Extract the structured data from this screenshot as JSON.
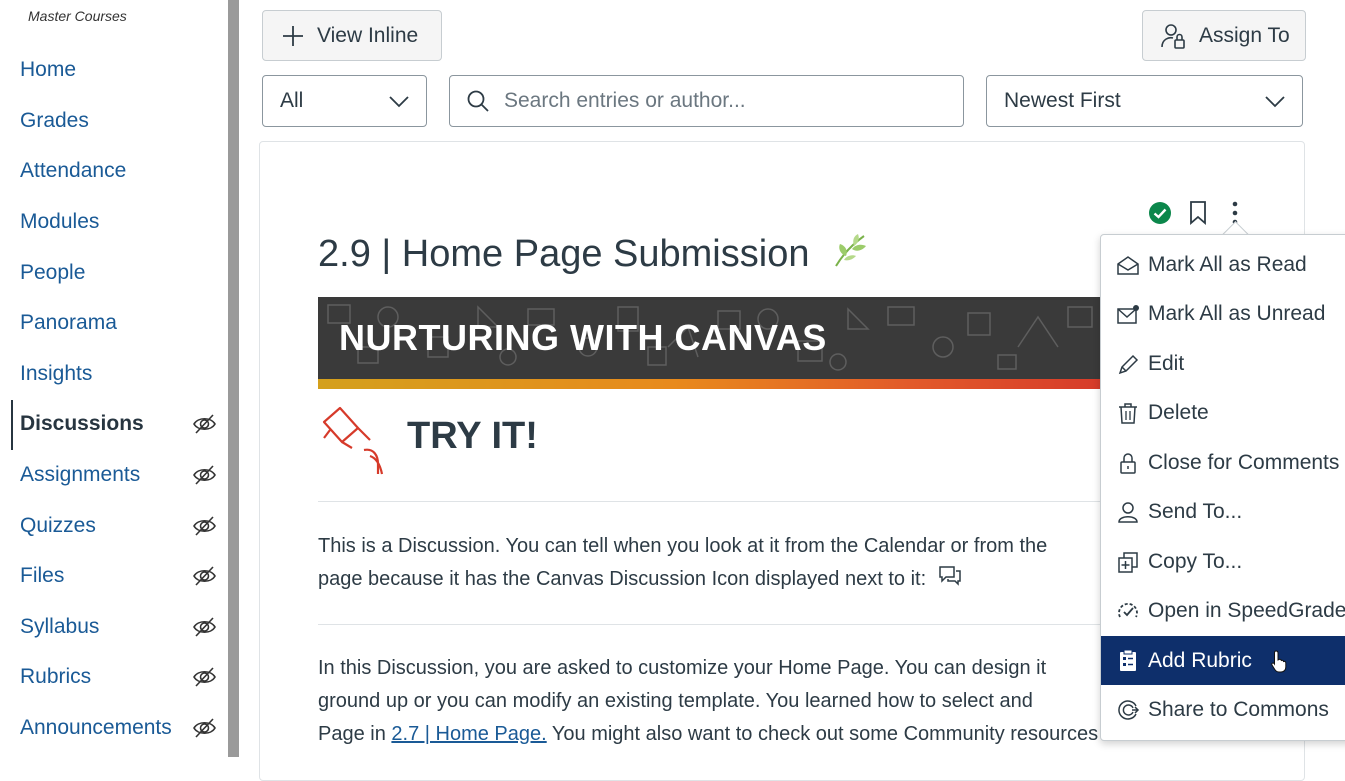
{
  "sidebar": {
    "section_label": "Master Courses",
    "items": [
      {
        "label": "Home",
        "hidden": false
      },
      {
        "label": "Grades",
        "hidden": false
      },
      {
        "label": "Attendance",
        "hidden": false
      },
      {
        "label": "Modules",
        "hidden": false
      },
      {
        "label": "People",
        "hidden": false
      },
      {
        "label": "Panorama",
        "hidden": false
      },
      {
        "label": "Insights",
        "hidden": false
      },
      {
        "label": "Discussions",
        "hidden": true,
        "active": true
      },
      {
        "label": "Assignments",
        "hidden": true
      },
      {
        "label": "Quizzes",
        "hidden": true
      },
      {
        "label": "Files",
        "hidden": true
      },
      {
        "label": "Syllabus",
        "hidden": true
      },
      {
        "label": "Rubrics",
        "hidden": true
      },
      {
        "label": "Announcements",
        "hidden": true
      }
    ]
  },
  "toolbar": {
    "view_inline_label": "View Inline",
    "assign_to_label": "Assign To",
    "filter_value": "All",
    "search_placeholder": "Search entries or author...",
    "sort_value": "Newest First"
  },
  "discussion": {
    "title": "2.9 | Home Page Submission",
    "banner_text": "NURTURING WITH CANVAS",
    "try_it": "TRY IT!",
    "para1": "This is a Discussion. You can tell when you look at it from the Calendar or from the",
    "para1_line2": "page because it has the Canvas Discussion Icon displayed next to it:",
    "para2_line1": "In this Discussion, you are asked to customize your Home Page. You can design it",
    "para2_line2": "ground up or you can modify an existing template. You learned how to select and",
    "para2_line3_pre": "Page in",
    "para2_link": "2.7 | Home Page.",
    "para2_line3_post": " You might also want to check out some Community resources around"
  },
  "menu": {
    "items": [
      {
        "label": "Mark All as Read",
        "icon": "envelope-open-icon"
      },
      {
        "label": "Mark All as Unread",
        "icon": "envelope-unread-icon"
      },
      {
        "label": "Edit",
        "icon": "pencil-icon"
      },
      {
        "label": "Delete",
        "icon": "trash-icon"
      },
      {
        "label": "Close for Comments",
        "icon": "lock-icon"
      },
      {
        "label": "Send To...",
        "icon": "user-icon"
      },
      {
        "label": "Copy To...",
        "icon": "copy-icon"
      },
      {
        "label": "Open in SpeedGrader",
        "icon": "speedgrader-icon"
      },
      {
        "label": "Add Rubric",
        "icon": "rubric-icon",
        "highlighted": true
      },
      {
        "label": "Share to Commons",
        "icon": "commons-icon"
      }
    ]
  },
  "colors": {
    "link": "#1a5a96",
    "highlight": "#0e2f6b",
    "published": "#0b874b"
  }
}
